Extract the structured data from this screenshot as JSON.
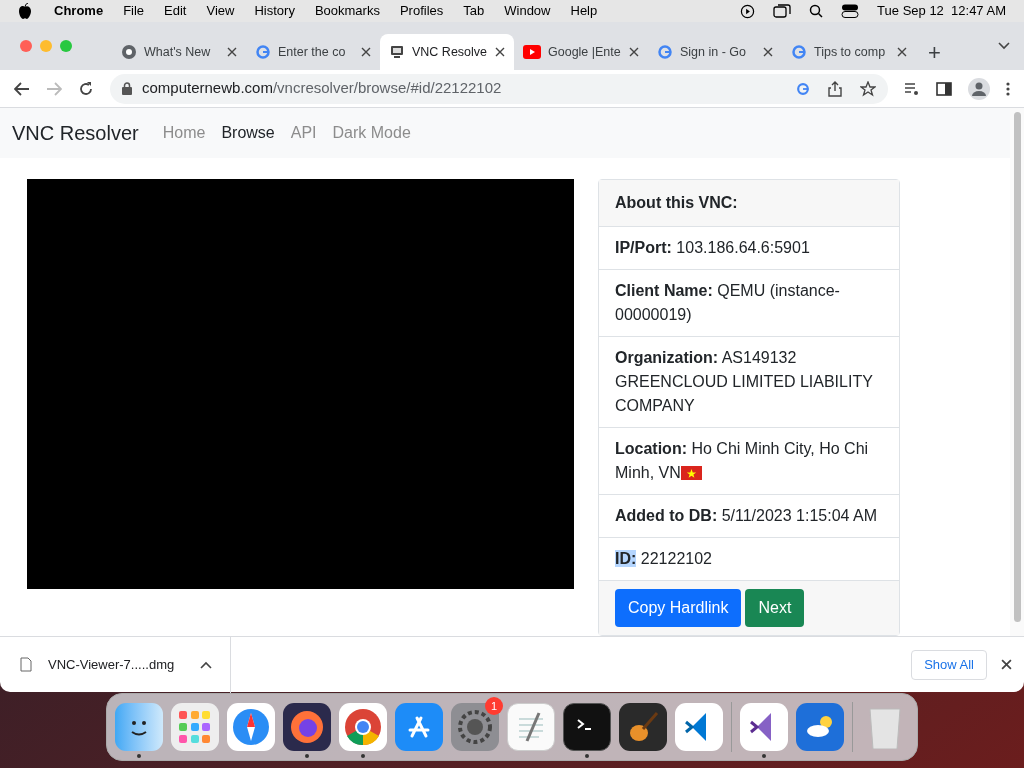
{
  "menubar": {
    "app": "Chrome",
    "menus": [
      "File",
      "Edit",
      "View",
      "History",
      "Bookmarks",
      "Profiles",
      "Tab",
      "Window",
      "Help"
    ],
    "clock": "Tue Sep 12  12:47 AM"
  },
  "tabs": [
    {
      "title": "What's New",
      "kind": "chrome",
      "selected": false
    },
    {
      "title": "Enter the co",
      "kind": "google",
      "selected": false
    },
    {
      "title": "VNC Resolve",
      "kind": "vnc",
      "selected": true
    },
    {
      "title": "Google |Ente",
      "kind": "youtube",
      "selected": false
    },
    {
      "title": "Sign in - Go",
      "kind": "google",
      "selected": false
    },
    {
      "title": "Tips to comp",
      "kind": "google",
      "selected": false
    }
  ],
  "new_tab": "+",
  "address": {
    "host": "computernewb.com",
    "path": "/vncresolver/browse/#id/22122102"
  },
  "navbar": {
    "brand": "VNC Resolver",
    "links": [
      {
        "label": "Home",
        "selected": false
      },
      {
        "label": "Browse",
        "selected": true
      },
      {
        "label": "API",
        "selected": false
      },
      {
        "label": "Dark Mode",
        "selected": false
      }
    ]
  },
  "info_card": {
    "header": "About this VNC:",
    "rows": [
      {
        "label": "IP/Port:",
        "value": "103.186.64.6:5901",
        "highlighted": false
      },
      {
        "label": "Client Name:",
        "value": "QEMU (instance-00000019)",
        "highlighted": false
      },
      {
        "label": "Organization:",
        "value": "AS149132 GREENCLOUD LIMITED LIABILITY COMPANY",
        "highlighted": false
      },
      {
        "label": "Location:",
        "value": "Ho Chi Minh City, Ho Chi Minh, VN",
        "kind": "with_flag",
        "highlighted": false
      },
      {
        "label": "Added to DB:",
        "value": "5/11/2023 1:15:04 AM",
        "highlighted": false
      },
      {
        "label": "ID:",
        "value": "22122102",
        "highlighted": true
      }
    ],
    "buttons": [
      {
        "label": "Copy Hardlink",
        "kind": "primary"
      },
      {
        "label": "Next",
        "kind": "success"
      }
    ]
  },
  "download_bar": {
    "file": "VNC-Viewer-7.....dmg",
    "show_all": "Show All"
  },
  "dock": [
    {
      "kind": "finder",
      "running": true
    },
    {
      "kind": "launchpad",
      "running": false
    },
    {
      "kind": "safari",
      "running": false
    },
    {
      "kind": "firefox",
      "running": true
    },
    {
      "kind": "chrome",
      "running": true
    },
    {
      "kind": "appstore",
      "running": false
    },
    {
      "kind": "settings",
      "running": false,
      "badge": "1"
    },
    {
      "kind": "textedit",
      "running": false
    },
    {
      "kind": "terminal",
      "running": true
    },
    {
      "kind": "garageband",
      "running": false
    },
    {
      "kind": "vscode",
      "running": false
    },
    {
      "kind": "divider"
    },
    {
      "kind": "visualstudio",
      "running": true
    },
    {
      "kind": "weather",
      "running": false
    },
    {
      "kind": "divider"
    },
    {
      "kind": "trash",
      "running": false
    }
  ]
}
